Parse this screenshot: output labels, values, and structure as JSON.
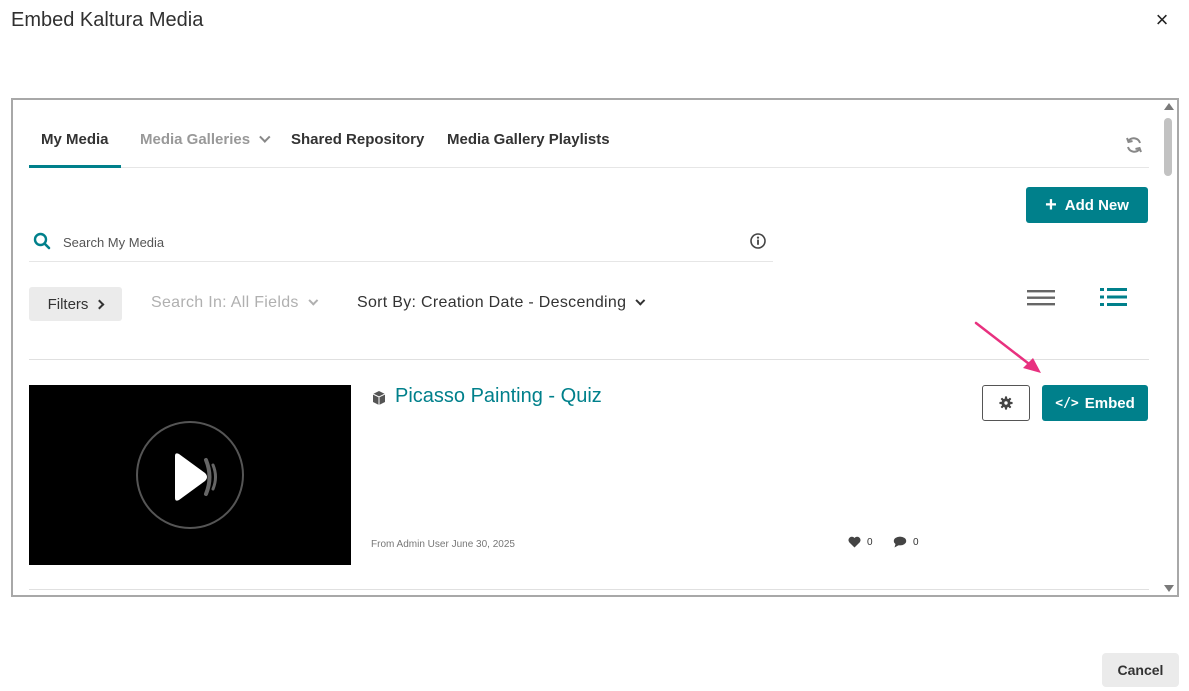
{
  "dialog": {
    "title": "Embed Kaltura Media",
    "close_label": "×",
    "cancel_label": "Cancel"
  },
  "tabs": [
    {
      "label": "My Media",
      "active": true
    },
    {
      "label": "Media Galleries",
      "active": false,
      "has_dropdown": true
    },
    {
      "label": "Shared Repository",
      "active": false
    },
    {
      "label": "Media Gallery Playlists",
      "active": false
    }
  ],
  "toolbar": {
    "add_new_label": "Add New",
    "search_placeholder": "Search My Media",
    "filters_label": "Filters",
    "search_in_label": "Search In: All Fields",
    "sort_by_label": "Sort By: Creation Date - Descending"
  },
  "entry": {
    "title": "Picasso Painting - Quiz",
    "meta": "From Admin User June 30, 2025",
    "likes": "0",
    "comments": "0",
    "embed_label": "Embed"
  },
  "colors": {
    "accent": "#00808b",
    "annotation_arrow": "#e8317f"
  },
  "icons": [
    "close-icon",
    "chevron-down-icon",
    "refresh-icon",
    "plus-icon",
    "search-icon",
    "info-icon",
    "chevron-right-icon",
    "list-compact-icon",
    "list-detailed-icon",
    "play-icon",
    "cube-icon",
    "heart-icon",
    "comment-icon",
    "gear-icon",
    "code-icon",
    "arrow-annotation"
  ]
}
